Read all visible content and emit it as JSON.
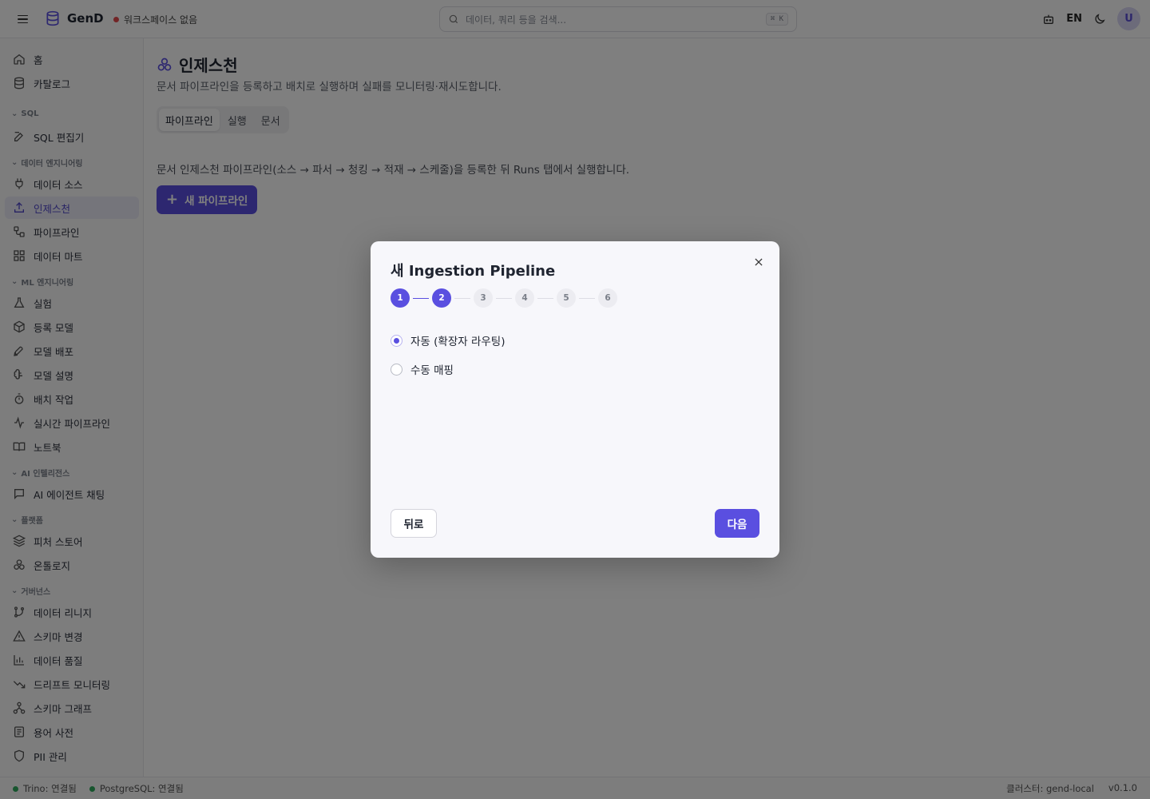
{
  "app": {
    "name": "GenD",
    "workspace": "워크스페이스 없음",
    "search_placeholder": "데이터, 쿼리 등을 검색...",
    "search_shortcut": "⌘ K",
    "lang": "EN",
    "avatar": "U"
  },
  "sidebar": {
    "top": [
      {
        "label": "홈",
        "icon": "home-icon"
      },
      {
        "label": "카탈로그",
        "icon": "database-icon"
      }
    ],
    "groups": [
      {
        "title": "SQL",
        "items": [
          {
            "label": "SQL 편집기",
            "icon": "edit-icon"
          }
        ]
      },
      {
        "title": "데이터 엔지니어링",
        "items": [
          {
            "label": "데이터 소스",
            "icon": "plug-icon"
          },
          {
            "label": "인제스천",
            "icon": "upload-icon",
            "active": true
          },
          {
            "label": "파이프라인",
            "icon": "workflow-icon"
          },
          {
            "label": "데이터 마트",
            "icon": "grid-icon"
          }
        ]
      },
      {
        "title": "ML 엔지니어링",
        "items": [
          {
            "label": "실험",
            "icon": "flask-icon"
          },
          {
            "label": "등록 모델",
            "icon": "box-icon"
          },
          {
            "label": "모델 배포",
            "icon": "rocket-icon"
          },
          {
            "label": "모델 설명",
            "icon": "brain-icon"
          },
          {
            "label": "배치 작업",
            "icon": "timer-icon"
          },
          {
            "label": "실시간 파이프라인",
            "icon": "activity-icon"
          },
          {
            "label": "노트북",
            "icon": "book-icon"
          }
        ]
      },
      {
        "title": "AI 인텔리전스",
        "items": [
          {
            "label": "AI 에이전트 채팅",
            "icon": "chat-icon"
          }
        ]
      },
      {
        "title": "플랫폼",
        "items": [
          {
            "label": "피처 스토어",
            "icon": "layers-icon"
          },
          {
            "label": "온톨로지",
            "icon": "ontology-icon"
          }
        ]
      },
      {
        "title": "거버넌스",
        "items": [
          {
            "label": "데이터 리니지",
            "icon": "branch-icon"
          },
          {
            "label": "스키마 변경",
            "icon": "warning-icon"
          },
          {
            "label": "데이터 품질",
            "icon": "bar-chart-icon"
          },
          {
            "label": "드리프트 모니터링",
            "icon": "trending-down-icon"
          },
          {
            "label": "스키마 그래프",
            "icon": "network-icon"
          },
          {
            "label": "용어 사전",
            "icon": "glossary-icon"
          },
          {
            "label": "PII 관리",
            "icon": "shield-icon"
          }
        ]
      }
    ]
  },
  "main": {
    "title": "인제스천",
    "description": "문서 파이프라인을 등록하고 배치로 실행하며 실패를 모니터링·재시도합니다.",
    "tabs": [
      {
        "label": "파이프라인",
        "active": true
      },
      {
        "label": "실행"
      },
      {
        "label": "문서"
      }
    ],
    "flow_text": "문서 인제스천 파이프라인(소스 → 파서 → 청킹 → 적재 → 스케줄)을 등록한 뒤 Runs 탭에서 실행합니다.",
    "new_button": "새 파이프라인"
  },
  "modal": {
    "title": "새 Ingestion Pipeline",
    "steps": [
      "1",
      "2",
      "3",
      "4",
      "5",
      "6"
    ],
    "current_step": 2,
    "options": [
      {
        "label": "자동 (확장자 라우팅)",
        "selected": true
      },
      {
        "label": "수동 매핑",
        "selected": false
      }
    ],
    "back_label": "뒤로",
    "next_label": "다음"
  },
  "status": {
    "trino": "Trino: 연결됨",
    "postgres": "PostgreSQL: 연결됨",
    "cluster": "클러스터: gend-local",
    "version": "v0.1.0"
  },
  "colors": {
    "accent": "#5a4fe0",
    "connected": "#2eaa5c",
    "no_workspace": "#e5484d"
  }
}
